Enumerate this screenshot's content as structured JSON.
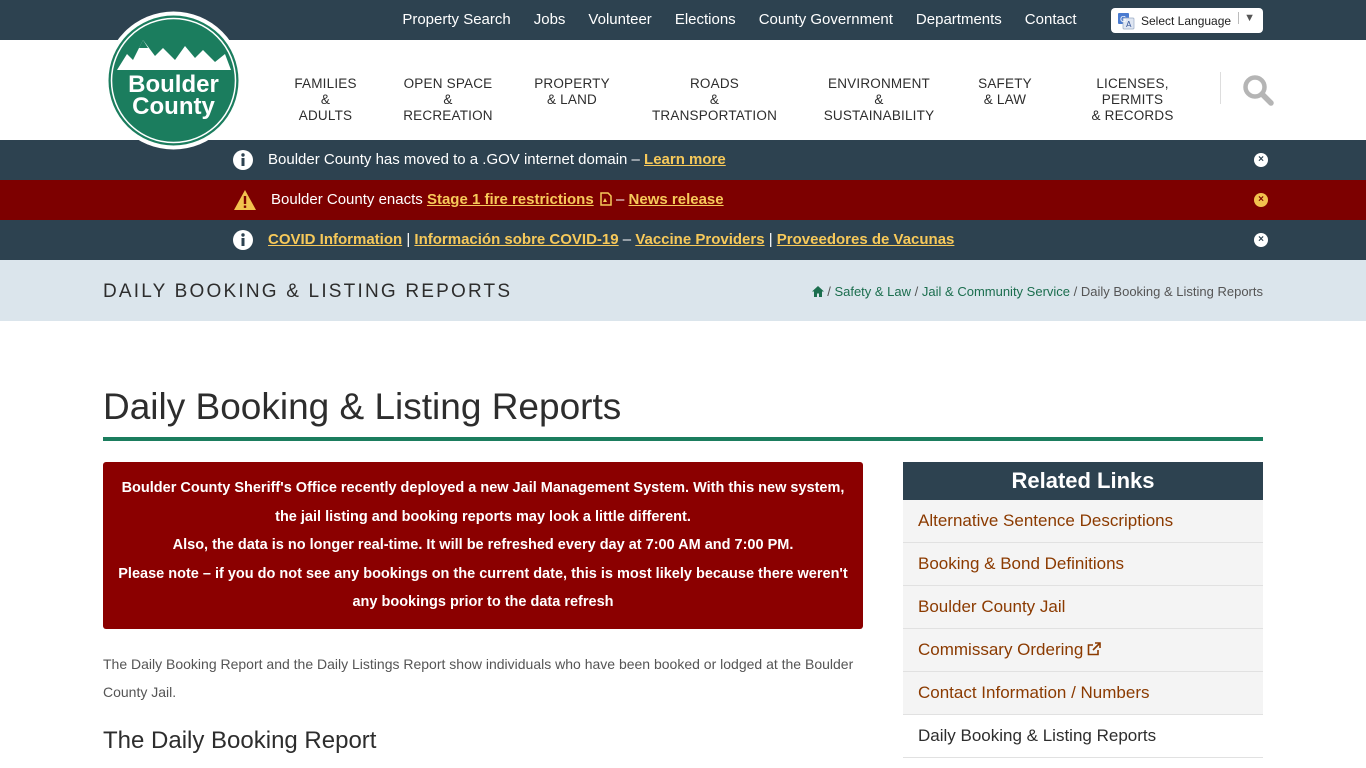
{
  "topnav": [
    "Property Search",
    "Jobs",
    "Volunteer",
    "Elections",
    "County Government",
    "Departments",
    "Contact"
  ],
  "language": {
    "label": "Select Language",
    "caret": "▼"
  },
  "logo": {
    "line1": "Boulder",
    "line2": "County"
  },
  "mainnav": [
    {
      "line1": "FAMILIES",
      "line2": "& ADULTS"
    },
    {
      "line1": "OPEN SPACE",
      "line2": "& RECREATION"
    },
    {
      "line1": "PROPERTY",
      "line2": "& LAND"
    },
    {
      "line1": "ROADS",
      "line2": "& TRANSPORTATION"
    },
    {
      "line1": "ENVIRONMENT",
      "line2": "& SUSTAINABILITY"
    },
    {
      "line1": "SAFETY",
      "line2": "& LAW"
    },
    {
      "line1": "LICENSES, PERMITS",
      "line2": "& RECORDS"
    }
  ],
  "alerts": {
    "gov": {
      "text": "Boulder County has moved to a .GOV internet domain – ",
      "link": "Learn more"
    },
    "fire": {
      "text": "Boulder County enacts ",
      "link1": "Stage 1 fire restrictions",
      "sep": " – ",
      "link2": "News release"
    },
    "covid": {
      "link1": "COVID Information",
      "sep1": " | ",
      "link2": "Información sobre COVID-19",
      "sep2": " – ",
      "link3": "Vaccine Providers",
      "sep3": " | ",
      "link4": "Proveedores de Vacunas"
    },
    "close_symbol": "×"
  },
  "titleband": {
    "title": "Daily Booking & Listing Reports",
    "crumbs": {
      "c1": "Safety & Law",
      "c2": "Jail & Community Service",
      "current": "Daily Booking & Listing Reports",
      "sep": "/"
    }
  },
  "main": {
    "title": "Daily Booking & Listing Reports",
    "notice": [
      "Boulder County Sheriff's Office recently deployed a new Jail Management System. With this new system,",
      "the jail listing and booking reports may look a little different.",
      "Also, the data is no longer real-time. It will be refreshed every day at 7:00 AM and 7:00 PM.",
      "Please note – if you do not see any bookings on the current date, this is most likely because there weren't",
      "any bookings prior to the data refresh"
    ],
    "intro": "The Daily Booking Report and the Daily Listings Report show individuals who have been booked or lodged at the Boulder County Jail.",
    "subheading": "The Daily Booking Report"
  },
  "sidebar": {
    "heading": "Related Links",
    "links": [
      "Alternative Sentence Descriptions",
      "Booking & Bond Definitions",
      "Boulder County Jail",
      "Commissary Ordering",
      "Contact Information / Numbers",
      "Daily Booking & Listing Reports"
    ]
  },
  "colors": {
    "topbar": "#2d4250",
    "brand_green": "#1b7d5e",
    "alert_red": "#7d0000",
    "notice_red": "#8b0000",
    "link_yellow": "#f7c95a",
    "sidebar_link": "#8b3a00"
  }
}
